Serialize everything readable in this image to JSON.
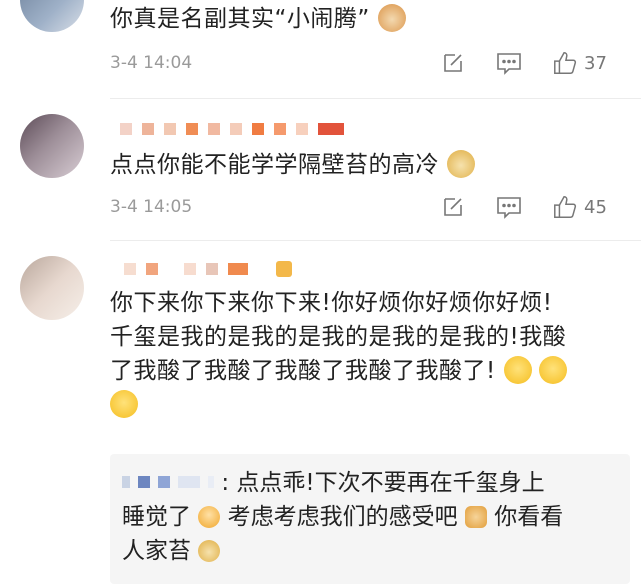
{
  "comments": [
    {
      "text": "你真是名副其实“小闹腾”",
      "time": "3-4 14:04",
      "likes": "37",
      "emoji": "cat-emoji"
    },
    {
      "text": "点点你能不能学学隔壁苔的高冷",
      "time": "3-4 14:05",
      "likes": "45",
      "emoji": "doge-emoji"
    },
    {
      "lines": [
        "你下来你下来你下来!你好烦你好烦你好烦!",
        "千玺是我的是我的是我的是我的是我的!我酸",
        "了我酸了我酸了我酸了我酸了我酸了!"
      ],
      "emoji": "crying-laughing-emoji"
    }
  ],
  "reply": {
    "line1": ": 点点乖!下次不要再在千玺身上",
    "line2a": "睡觉了",
    "line2b": "考虑考虑我们的感受吧",
    "line2c": "你看看",
    "line3": "人家苔"
  },
  "colors": {
    "text": "#222222",
    "meta": "#9a9a9a",
    "icon": "#777777",
    "reply_bg": "#f5f5f5"
  }
}
